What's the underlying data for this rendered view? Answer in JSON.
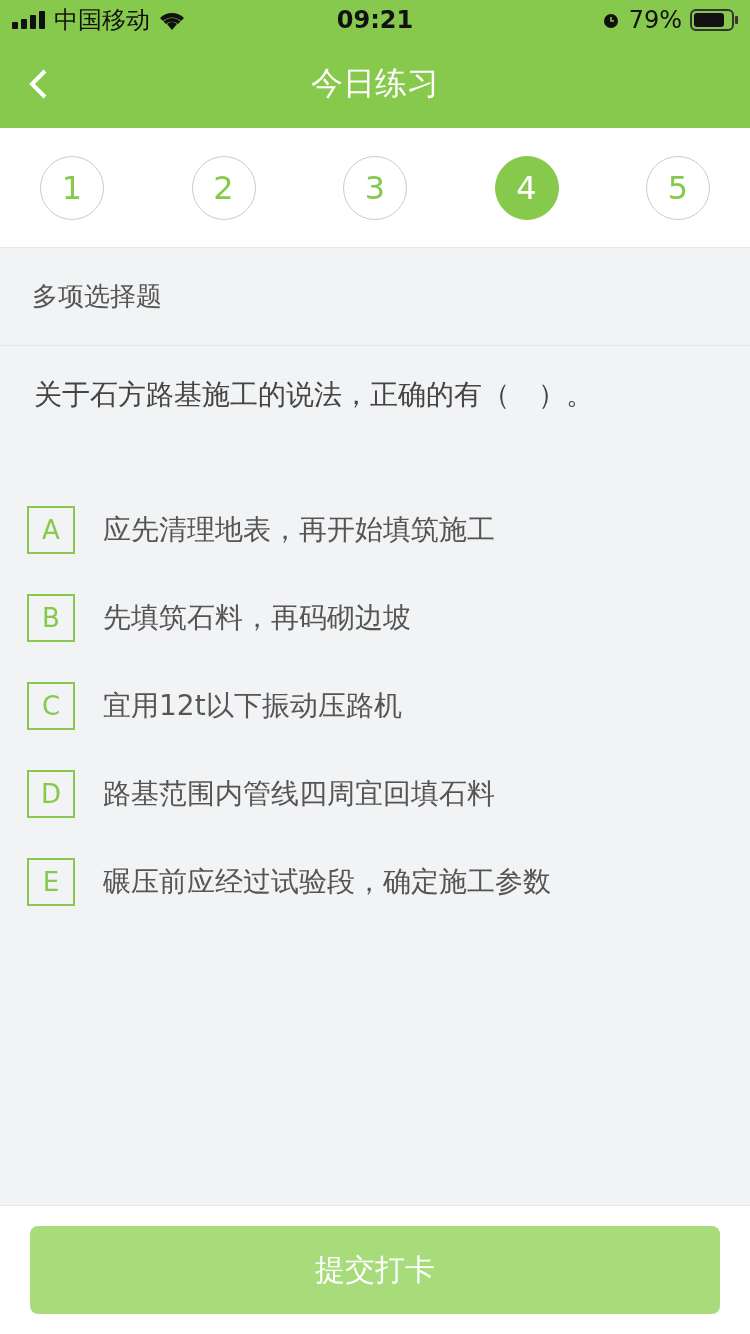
{
  "status_bar": {
    "carrier": "中国移动",
    "time": "09:21",
    "battery": "79%"
  },
  "nav": {
    "title": "今日练习"
  },
  "questions": [
    {
      "label": "1",
      "selected": false
    },
    {
      "label": "2",
      "selected": false
    },
    {
      "label": "3",
      "selected": false
    },
    {
      "label": "4",
      "selected": true
    },
    {
      "label": "5",
      "selected": false
    }
  ],
  "question_type": "多项选择题",
  "question": "关于石方路基施工的说法，正确的有（　）。",
  "options": [
    {
      "letter": "A",
      "text": "应先清理地表，再开始填筑施工",
      "selected": false
    },
    {
      "letter": "B",
      "text": "先填筑石料，再码砌边坡",
      "selected": false
    },
    {
      "letter": "C",
      "text": "宜用12t以下振动压路机",
      "selected": false
    },
    {
      "letter": "D",
      "text": "路基范围内管线四周宜回填石料",
      "selected": false
    },
    {
      "letter": "E",
      "text": "碾压前应经过试验段，确定施工参数",
      "selected": false
    }
  ],
  "submit": {
    "label": "提交打卡",
    "disabled": true
  }
}
